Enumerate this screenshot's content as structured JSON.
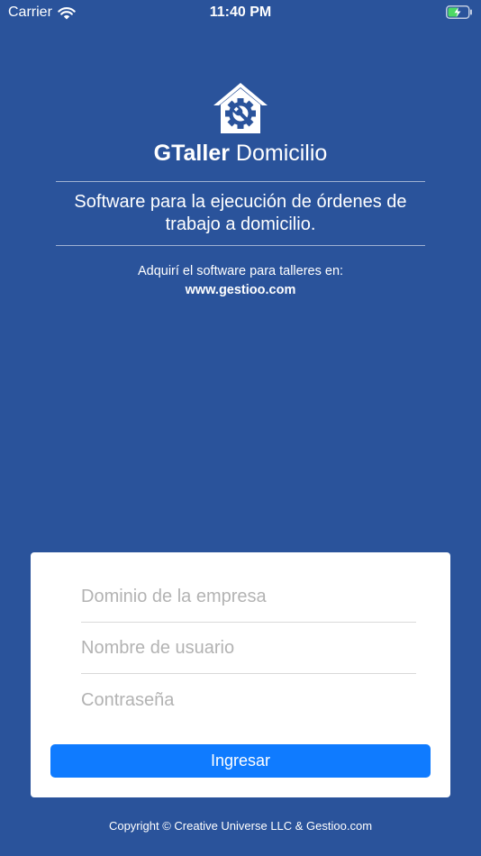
{
  "status_bar": {
    "carrier": "Carrier",
    "time": "11:40 PM",
    "battery_color": "#4cd964"
  },
  "header": {
    "title_strong": "GTaller",
    "title_rest": " Domicilio",
    "tagline": "Software para la ejecución de órdenes de trabajo a domicilio.",
    "promo_text": "Adquirí el software para talleres en:",
    "promo_link": "www.gestioo.com",
    "logo_icon": "house-gear-wrench-icon"
  },
  "login": {
    "domain_placeholder": "Dominio de la empresa",
    "username_placeholder": "Nombre de usuario",
    "password_placeholder": "Contraseña",
    "submit_label": "Ingresar",
    "accent_color": "#0f7bff"
  },
  "footer": {
    "copyright": "Copyright © Creative Universe LLC & Gestioo.com"
  },
  "colors": {
    "background": "#2a539b",
    "card": "#ffffff"
  }
}
